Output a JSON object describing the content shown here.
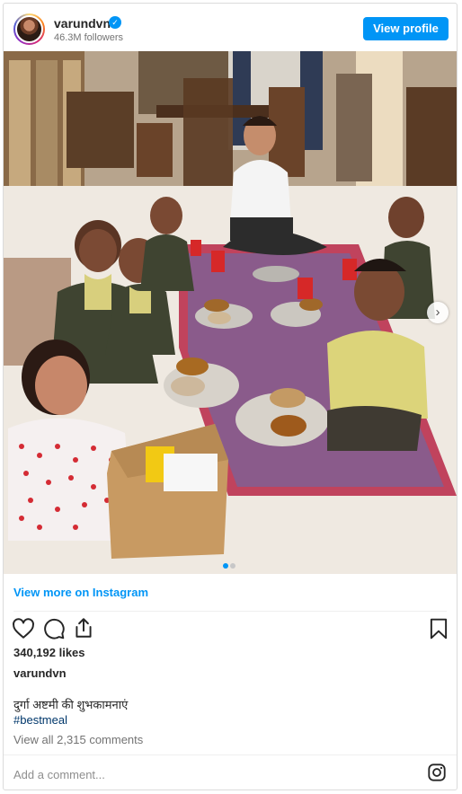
{
  "header": {
    "username": "varundvn",
    "verified_mark": "✓",
    "followers": "46.3M followers",
    "view_profile": "View profile"
  },
  "photo": {
    "next_arrow": "›",
    "carousel_dots": 2,
    "active_dot": 0
  },
  "view_more": "View more on Instagram",
  "actions": {
    "like_icon": "heart-icon",
    "comment_icon": "comment-icon",
    "share_icon": "share-icon",
    "save_icon": "bookmark-icon"
  },
  "likes": "340,192 likes",
  "caption_user": "varundvn",
  "caption_text": "दुर्गा अष्टमी की शुभकामनाएं",
  "hashtag": "#bestmeal",
  "comments_link": "View all 2,315 comments",
  "add_comment_placeholder": "Add a comment...",
  "footer_icon": "instagram-icon",
  "colors": {
    "accent": "#0095f6",
    "hashtag": "#00376b",
    "muted": "#737373"
  }
}
